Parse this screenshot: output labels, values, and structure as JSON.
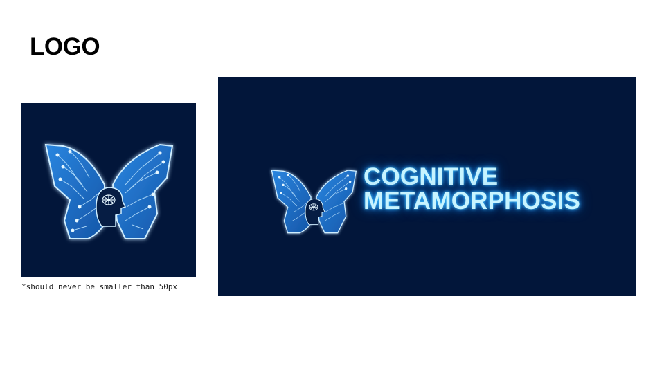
{
  "heading": "LOGO",
  "square_logo": {
    "background": "#02163a",
    "wing_fill": "#1f6fc9",
    "glow": "#7fd3ff",
    "icon": "butterfly-circuit-icon",
    "brain_icon": "brain-icon"
  },
  "size_note": "*should never be smaller than 50px",
  "wide_logo": {
    "background": "#02163a",
    "wordmark_line1": "COGNITIVE",
    "wordmark_line2": "METAMORPHOSIS",
    "wordmark_color": "#c7f4ff"
  }
}
